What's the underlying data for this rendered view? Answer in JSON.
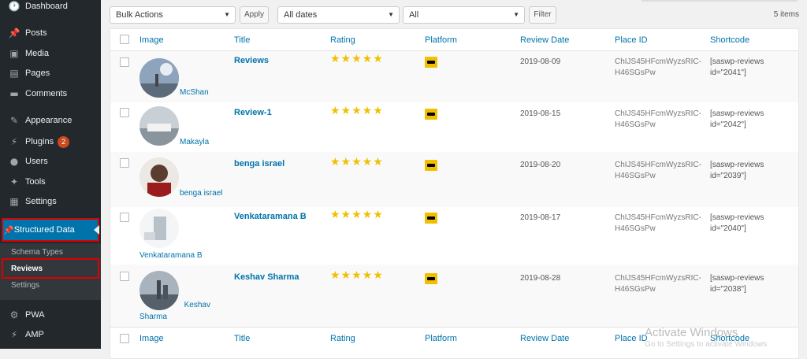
{
  "sidebar": {
    "items": [
      {
        "label": "Dashboard",
        "icon": "dashboard-icon",
        "glyph": "🕐"
      },
      {
        "label": "Posts",
        "icon": "pin-icon",
        "glyph": "📌"
      },
      {
        "label": "Media",
        "icon": "media-icon",
        "glyph": "▣"
      },
      {
        "label": "Pages",
        "icon": "pages-icon",
        "glyph": "▤"
      },
      {
        "label": "Comments",
        "icon": "comment-icon",
        "glyph": "▬"
      },
      {
        "label": "Appearance",
        "icon": "brush-icon",
        "glyph": "✎"
      },
      {
        "label": "Plugins",
        "icon": "plugin-icon",
        "glyph": "⚡",
        "badge": "2"
      },
      {
        "label": "Users",
        "icon": "user-icon",
        "glyph": "●"
      },
      {
        "label": "Tools",
        "icon": "wrench-icon",
        "glyph": "✦"
      },
      {
        "label": "Settings",
        "icon": "settings-icon",
        "glyph": "▦"
      }
    ],
    "active": {
      "label": "Structured Data",
      "icon": "pin-icon",
      "glyph": "📌"
    },
    "submenu": [
      "Schema Types",
      "Reviews",
      "Settings"
    ],
    "bottom": [
      {
        "label": "PWA",
        "icon": "gear-icon",
        "glyph": "⚙"
      },
      {
        "label": "AMP",
        "icon": "lightning-icon",
        "glyph": "⚡"
      }
    ]
  },
  "toolbar": {
    "bulk_actions": "Bulk Actions",
    "apply": "Apply",
    "dates": "All dates",
    "platform_filter": "All",
    "filter": "Filter",
    "items_count": "5 items"
  },
  "table": {
    "columns": [
      "Image",
      "Title",
      "Rating",
      "Platform",
      "Review Date",
      "Place ID",
      "Shortcode"
    ],
    "rows": [
      {
        "avatar_name": "McShan",
        "title": "Reviews",
        "stars": "★★★★★",
        "date": "2019-08-09",
        "place_line1": "ChIJS45HFcmWyzsRIC-",
        "place_line2": "H46SGsPw",
        "short_line1": "[saswp-reviews",
        "short_line2": "id=\"2041\"]",
        "avatar_color": "#8ea4bd"
      },
      {
        "avatar_name": "Makayla",
        "title": "Review-1",
        "stars": "★★★★★",
        "date": "2019-08-15",
        "place_line1": "ChIJS45HFcmWyzsRIC-",
        "place_line2": "H46SGsPw",
        "short_line1": "[saswp-reviews",
        "short_line2": "id=\"2042\"]",
        "avatar_color": "#b6c0c8"
      },
      {
        "avatar_name": "benga israel",
        "title": "benga israel",
        "stars": "★★★★★",
        "date": "2019-08-20",
        "place_line1": "ChIJS45HFcmWyzsRIC-",
        "place_line2": "H46SGsPw",
        "short_line1": "[saswp-reviews",
        "short_line2": "id=\"2039\"]",
        "avatar_color": "#5a3d2e"
      },
      {
        "avatar_name": "Venkataramana B",
        "title": "Venkataramana B",
        "stars": "★★★★★",
        "date": "2019-08-17",
        "place_line1": "ChIJS45HFcmWyzsRIC-",
        "place_line2": "H46SGsPw",
        "short_line1": "[saswp-reviews",
        "short_line2": "id=\"2040\"]",
        "avatar_color": "#d9dde0"
      },
      {
        "avatar_name": "Keshav Sharma",
        "title": "Keshav Sharma",
        "stars": "★★★★★",
        "date": "2019-08-28",
        "place_line1": "ChIJS45HFcmWyzsRIC-",
        "place_line2": "H46SGsPw",
        "short_line1": "[saswp-reviews",
        "short_line2": "id=\"2038\"]",
        "avatar_color": "#7c8894"
      }
    ]
  },
  "watermark": {
    "line1": "Activate Windows",
    "line2": "Go to Settings to activate Windows"
  }
}
